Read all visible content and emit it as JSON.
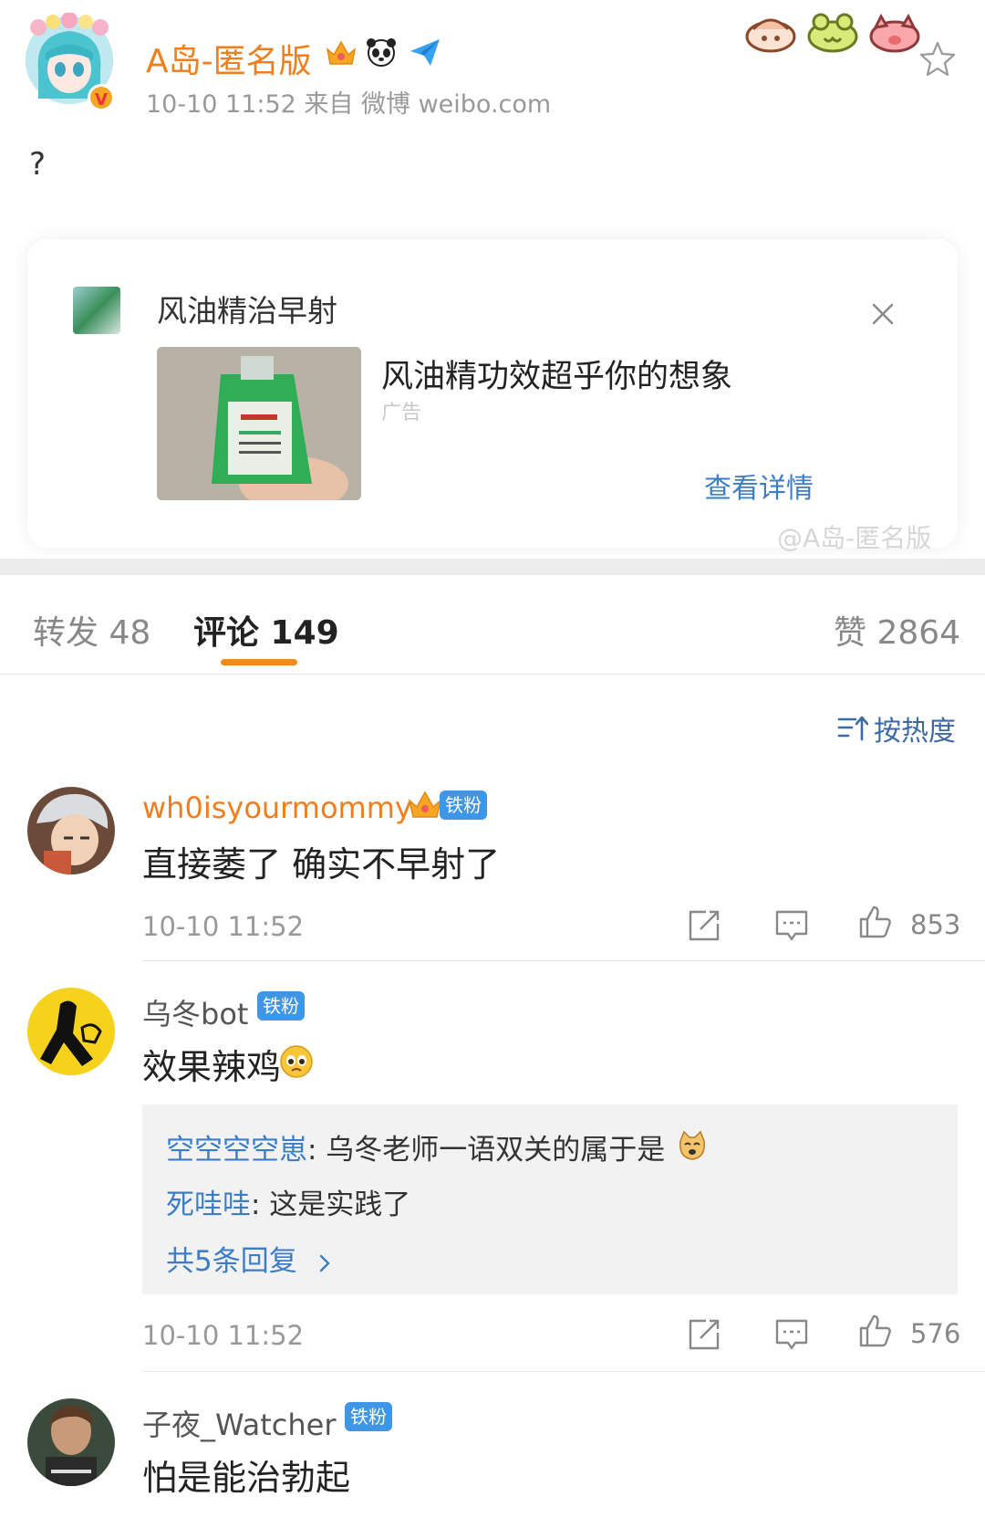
{
  "post": {
    "username": "A岛-匿名版",
    "meta": "10-10 11:52   来自 微博 weibo.com",
    "text": "?",
    "verified_badge": "V",
    "badges": [
      "crown-icon",
      "panda-icon",
      "paper-plane-icon"
    ],
    "stickers": [
      "dumpling-sticker",
      "frog-sticker",
      "pig-sticker"
    ]
  },
  "ad": {
    "title": "风油精治早射",
    "headline": "风油精功效超乎你的想象",
    "label": "广告",
    "detail_link": "查看详情",
    "watermark": "@A岛-匿名版"
  },
  "tabs": {
    "repost": "转发 48",
    "comment": "评论 149",
    "like": "赞 2864"
  },
  "sort": {
    "label": "按热度"
  },
  "comments": [
    {
      "username": "wh0isyourmommy",
      "badge": "铁粉",
      "text": "直接萎了 确实不早射了",
      "time": "10-10 11:52",
      "likes": "853"
    },
    {
      "username": "乌冬bot",
      "badge": "铁粉",
      "text": "效果辣鸡",
      "time": "10-10 11:52",
      "likes": "576",
      "replies": [
        {
          "user": "空空空空崽",
          "text": ": 乌冬老师一语双关的属于是"
        },
        {
          "user": "死哇哇",
          "text": ": 这是实践了"
        }
      ],
      "more_replies": "共5条回复"
    },
    {
      "username": "子夜_Watcher",
      "badge": "铁粉",
      "text": "怕是能治勃起"
    }
  ],
  "colors": {
    "accent_orange": "#f07e1c",
    "link_blue": "#3d7dc7",
    "fan_badge": "#3f95e6"
  }
}
